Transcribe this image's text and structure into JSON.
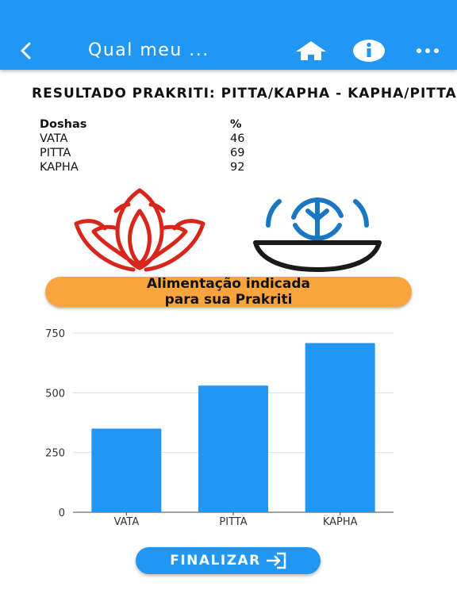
{
  "appbar": {
    "title": "Qual meu ...",
    "icons": {
      "back": "back-arrow-icon",
      "home": "home-icon",
      "info": "info-icon",
      "more": "more-icon"
    },
    "color": "#2196f3"
  },
  "result": {
    "title": "RESULTADO PRAKRITI: PITTA/KAPHA - KAPHA/PITTA",
    "table": {
      "headers": [
        "Doshas",
        "%"
      ],
      "rows": [
        {
          "name": "VATA",
          "pct": "46"
        },
        {
          "name": "PITTA",
          "pct": "69"
        },
        {
          "name": "KAPHA",
          "pct": "92"
        }
      ]
    }
  },
  "emblems": {
    "left": "lotus-icon",
    "right": "tree-bowl-icon"
  },
  "food_button": {
    "line1": "Alimentação indicada",
    "line2": "para sua Prakriti",
    "color": "#f9a43d"
  },
  "chart_data": {
    "type": "bar",
    "categories": [
      "VATA",
      "PITTA",
      "KAPHA"
    ],
    "values": [
      350,
      530,
      708
    ],
    "ylim": [
      0,
      750
    ],
    "yticks": [
      "0",
      "250",
      "500",
      "750"
    ],
    "grid": true,
    "bar_color": "#2196f3"
  },
  "finalizar": {
    "label": "FINALIZAR",
    "icon": "exit-icon"
  }
}
